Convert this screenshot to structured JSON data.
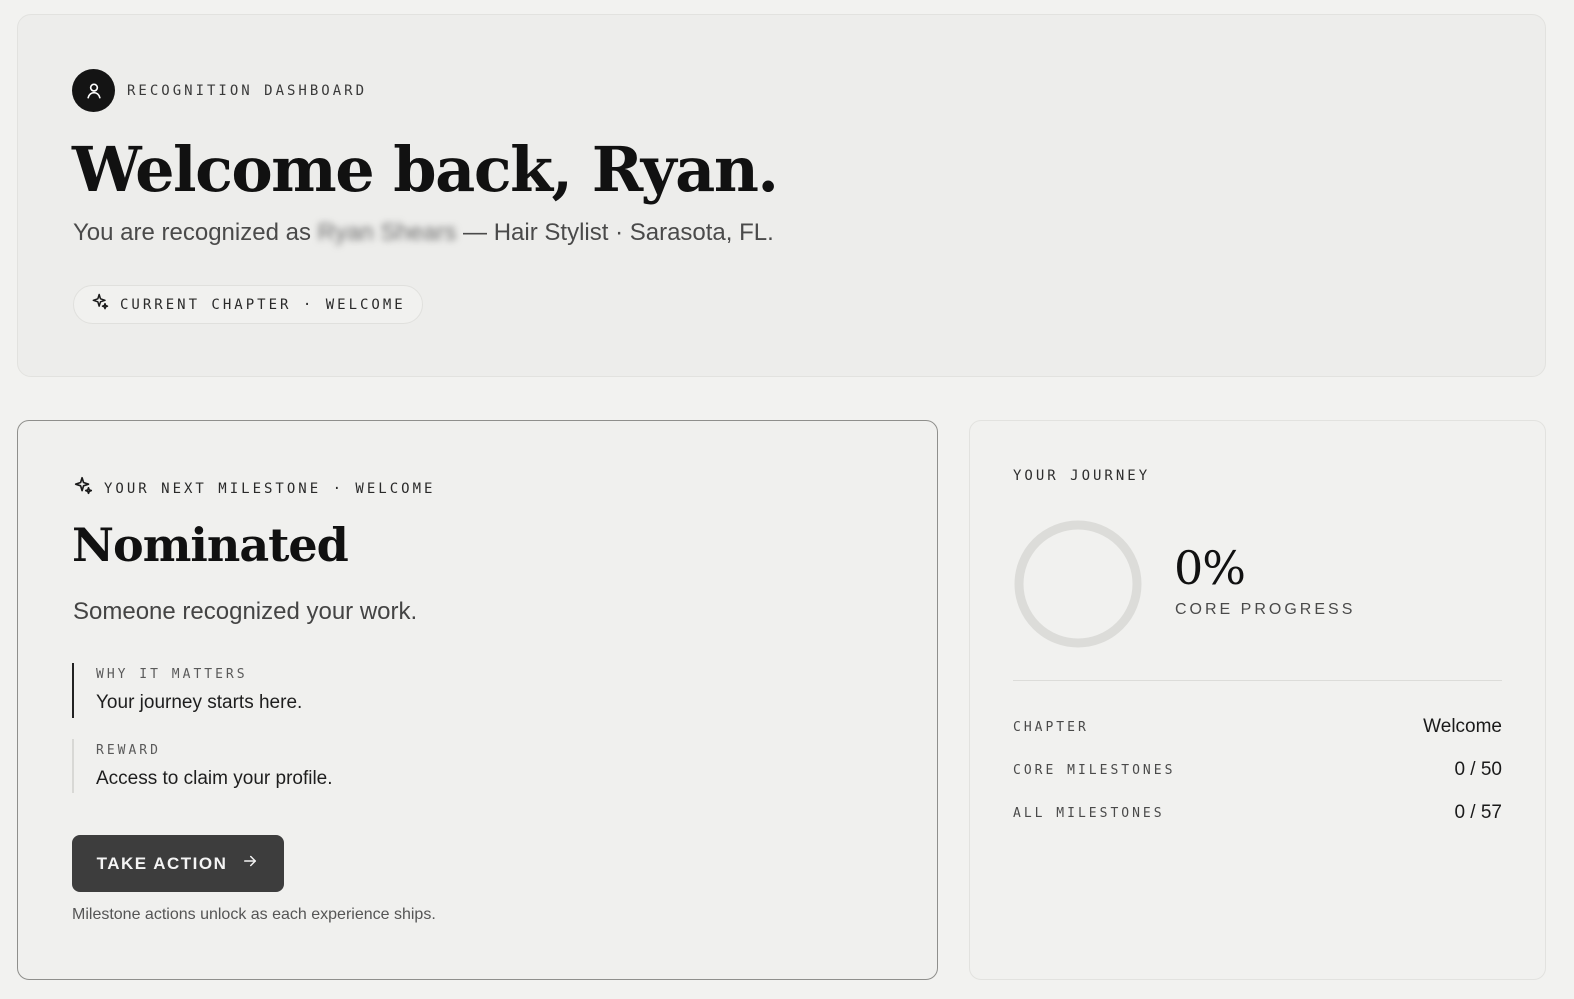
{
  "hero": {
    "eyebrow": "RECOGNITION DASHBOARD",
    "title": "Welcome back, Ryan.",
    "subtitle_prefix": "You are recognized as",
    "subtitle_name": "Ryan Shears",
    "subtitle_suffix": "— Hair Stylist · Sarasota, FL.",
    "chapter_pill": "CURRENT CHAPTER · WELCOME",
    "icons": {
      "avatar": "user-icon",
      "pill": "sparkle-icon"
    }
  },
  "milestone": {
    "eyebrow": "YOUR NEXT MILESTONE · WELCOME",
    "title": "Nominated",
    "description": "Someone recognized your work.",
    "why_label": "WHY IT MATTERS",
    "why_text": "Your journey starts here.",
    "reward_label": "REWARD",
    "reward_text": "Access to claim your profile.",
    "action_label": "TAKE ACTION",
    "footnote": "Milestone actions unlock as each experience ships."
  },
  "journey": {
    "title": "YOUR JOURNEY",
    "progress_value": "0%",
    "progress_fraction": 0,
    "progress_label": "CORE PROGRESS",
    "stats": [
      {
        "label": "CHAPTER",
        "value": "Welcome"
      },
      {
        "label": "CORE MILESTONES",
        "value": "0 / 50"
      },
      {
        "label": "ALL MILESTONES",
        "value": "0 / 57"
      }
    ]
  },
  "colors": {
    "background": "#f2f2f0",
    "primary_button": "#3d3d3d",
    "avatar": "#141414",
    "ring_track": "#dcdcd9"
  }
}
